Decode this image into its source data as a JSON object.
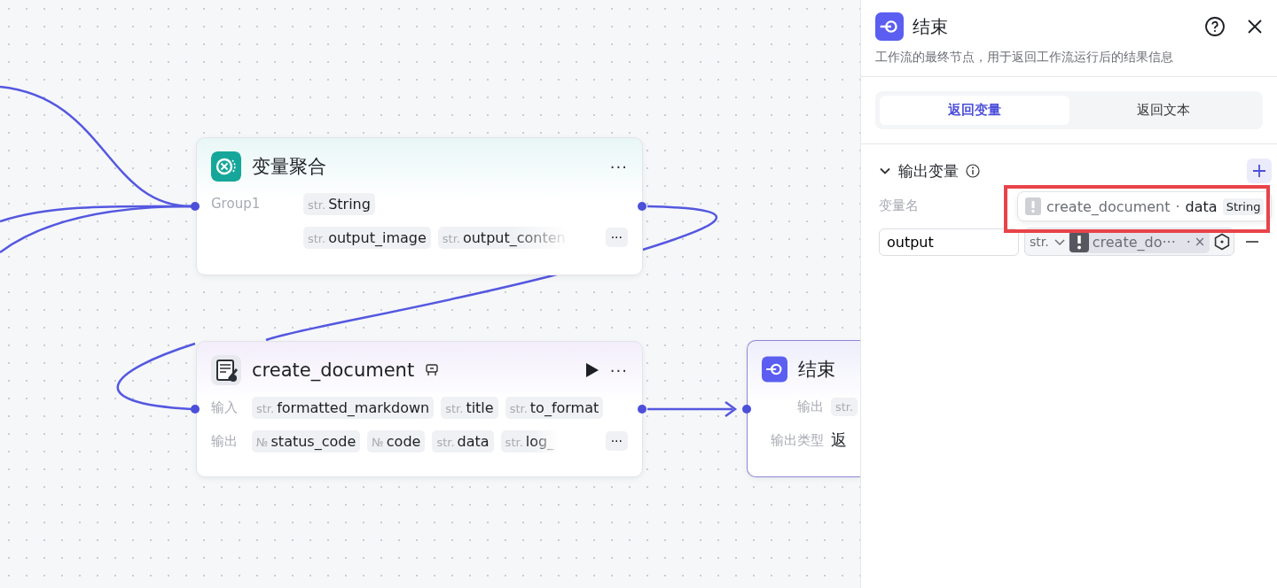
{
  "canvas": {
    "nodes": [
      {
        "kind": "aggregate",
        "title": "变量聚合",
        "menu": "···",
        "rows": [
          {
            "label": "Group1",
            "chips": [
              {
                "type": "str.",
                "name": "String",
                "faded": false
              }
            ]
          },
          {
            "chips": [
              {
                "type": "str.",
                "name": "output_image",
                "faded": false
              },
              {
                "type": "str.",
                "name": "output_conten",
                "faded": true
              }
            ],
            "more": "···"
          }
        ]
      },
      {
        "kind": "plugin",
        "title": "create_document",
        "menu": "···",
        "rows": [
          {
            "label": "输入",
            "chips": [
              {
                "type": "str.",
                "name": "formatted_markdown",
                "faded": false
              },
              {
                "type": "str.",
                "name": "title",
                "faded": false
              },
              {
                "type": "str.",
                "name": "to_format",
                "faded": false
              }
            ]
          },
          {
            "label": "输出",
            "chips": [
              {
                "type": "№",
                "name": "status_code",
                "faded": false
              },
              {
                "type": "№",
                "name": "code",
                "faded": false
              },
              {
                "type": "str.",
                "name": "data",
                "faded": false
              },
              {
                "type": "str.",
                "name": "log_",
                "faded": true
              }
            ],
            "more": "···"
          }
        ]
      },
      {
        "kind": "end",
        "title": "结束",
        "rows": [
          {
            "label": "输出",
            "chips": [
              {
                "type": "str.",
                "faded": false
              }
            ]
          },
          {
            "label": "输出类型",
            "value": "返"
          }
        ]
      }
    ]
  },
  "panel": {
    "title": "结束",
    "description": "工作流的最终节点，用于返回工作流运行后的结果信息",
    "tabs": [
      {
        "label": "返回变量",
        "selected": true
      },
      {
        "label": "返回文本",
        "selected": false
      }
    ],
    "section": {
      "title": "输出变量",
      "expanded": true,
      "column_label": "变量名",
      "tooltip": {
        "node": "create_document",
        "separator": "·",
        "field": "data",
        "type": "String"
      },
      "variables": [
        {
          "name": "output",
          "type": "str.",
          "ref": "create_do···",
          "separator": "·",
          "remove": "×"
        }
      ]
    }
  }
}
